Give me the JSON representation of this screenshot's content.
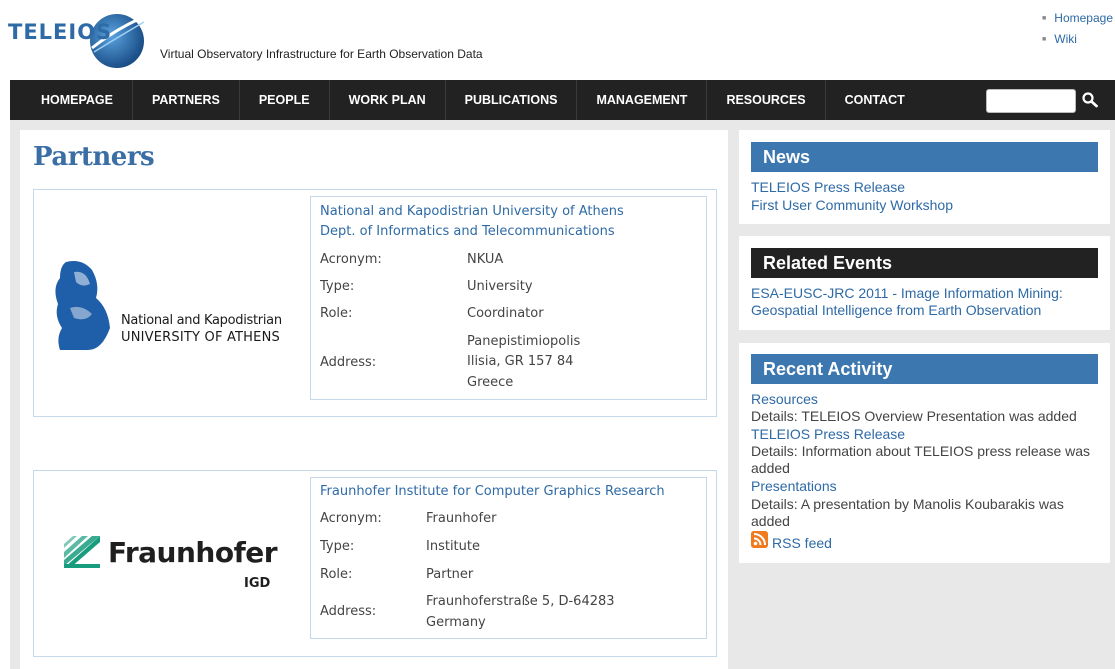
{
  "header": {
    "logo_text": "TELEIOS",
    "tagline": "Virtual Observatory Infrastructure for Earth Observation Data",
    "top_links": [
      "Homepage",
      "Wiki"
    ]
  },
  "nav": {
    "items": [
      "HOMEPAGE",
      "PARTNERS",
      "PEOPLE",
      "WORK PLAN",
      "PUBLICATIONS",
      "MANAGEMENT",
      "RESOURCES",
      "CONTACT"
    ],
    "search": {
      "value": "",
      "placeholder": ""
    }
  },
  "main": {
    "title": "Partners",
    "partners": [
      {
        "name_lines": [
          "National and Kapodistrian University of Athens",
          "Dept. of Informatics and Telecommunications"
        ],
        "logo_lines": [
          "National and Kapodistrian",
          "UNIVERSITY OF ATHENS"
        ],
        "labels": {
          "acronym": "Acronym:",
          "type": "Type:",
          "role": "Role:",
          "address": "Address:"
        },
        "acronym": "NKUA",
        "type": "University",
        "role": "Coordinator",
        "address_lines": [
          "Panepistimiopolis",
          "Ilisia, GR 157 84",
          "Greece"
        ]
      },
      {
        "name_lines": [
          "Fraunhofer Institute for Computer Graphics Research"
        ],
        "logo_lines": [
          "Fraunhofer",
          "IGD"
        ],
        "labels": {
          "acronym": "Acronym:",
          "type": "Type:",
          "role": "Role:",
          "address": "Address:"
        },
        "acronym": "Fraunhofer",
        "type": "Institute",
        "role": "Partner",
        "address_lines": [
          "Fraunhoferstraße 5, D-64283",
          "Germany"
        ]
      }
    ]
  },
  "sidebar": {
    "news": {
      "title": "News",
      "links": [
        "TELEIOS Press Release",
        "First User Community Workshop"
      ]
    },
    "events": {
      "title": "Related Events",
      "links": [
        "ESA-EUSC-JRC 2011 - Image Information Mining:",
        "Geospatial Intelligence from Earth Observation"
      ]
    },
    "activity": {
      "title": "Recent Activity",
      "items": [
        {
          "link": "Resources",
          "detail_lines": [
            "Details: TELEIOS Overview Presentation was added"
          ]
        },
        {
          "link": "TELEIOS Press Release",
          "detail_lines": [
            "Details: Information about TELEIOS press release was",
            "added"
          ]
        },
        {
          "link": "Presentations",
          "detail_lines": [
            "Details: A presentation by Manolis Koubarakis was",
            "added"
          ]
        }
      ],
      "rss_label": "RSS feed"
    }
  },
  "colors": {
    "accent": "#3d77b0",
    "nav_bg": "#222222",
    "link": "#2e6aa6",
    "rss": "#f07b1e"
  }
}
